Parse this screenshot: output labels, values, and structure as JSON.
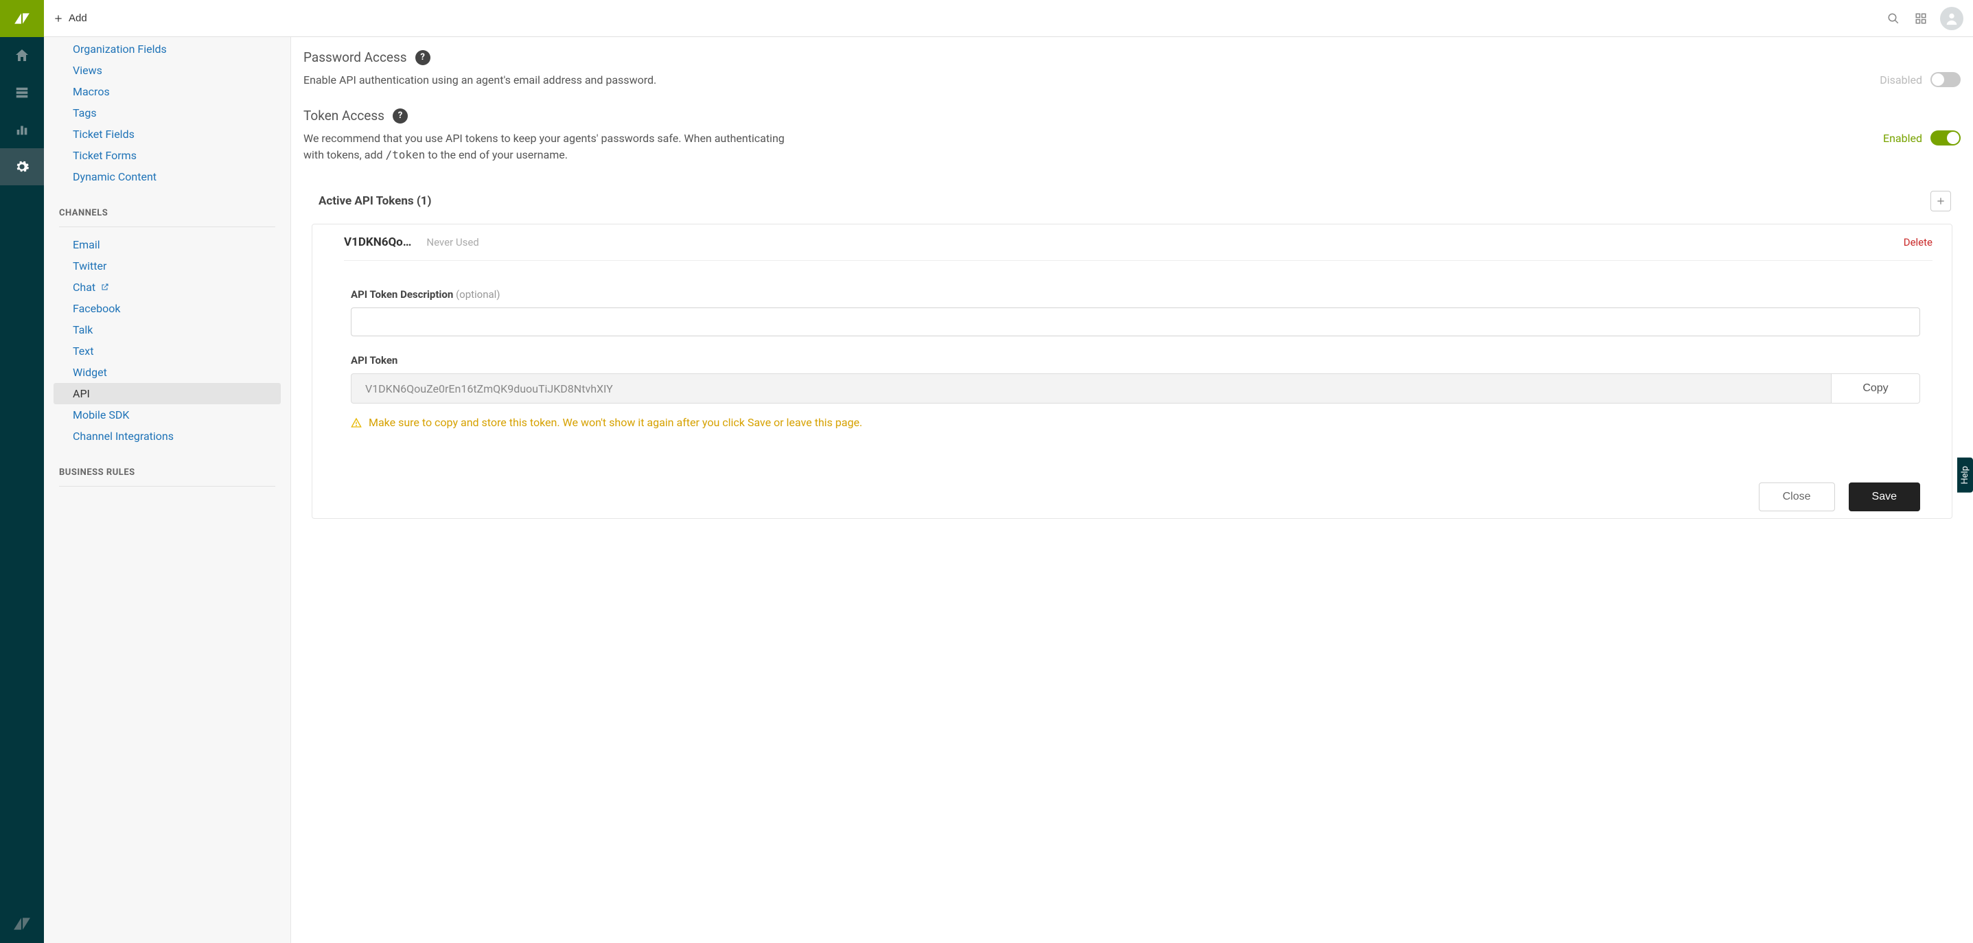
{
  "topbar": {
    "add_label": "Add"
  },
  "sidebar": {
    "manage_items": [
      {
        "label": "Organization Fields"
      },
      {
        "label": "Views"
      },
      {
        "label": "Macros"
      },
      {
        "label": "Tags"
      },
      {
        "label": "Ticket Fields"
      },
      {
        "label": "Ticket Forms"
      },
      {
        "label": "Dynamic Content"
      }
    ],
    "channels_header": "CHANNELS",
    "channels_items": [
      {
        "label": "Email"
      },
      {
        "label": "Twitter"
      },
      {
        "label": "Chat",
        "external": true
      },
      {
        "label": "Facebook"
      },
      {
        "label": "Talk"
      },
      {
        "label": "Text"
      },
      {
        "label": "Widget"
      },
      {
        "label": "API",
        "selected": true
      },
      {
        "label": "Mobile SDK"
      },
      {
        "label": "Channel Integrations"
      }
    ],
    "business_header": "BUSINESS RULES"
  },
  "password_section": {
    "title": "Password Access",
    "desc": "Enable API authentication using an agent's email address and password.",
    "state_label": "Disabled",
    "enabled": false
  },
  "token_section": {
    "title": "Token Access",
    "desc_pre": "We recommend that you use API tokens to keep your agents' passwords safe. When authenticating with tokens, add ",
    "desc_code": "/token",
    "desc_post": " to the end of your username.",
    "state_label": "Enabled",
    "enabled": true
  },
  "tokens_panel": {
    "header": "Active API Tokens (1)",
    "token_short": "V1DKN6Qo…",
    "token_meta": "Never Used",
    "delete_label": "Delete",
    "desc_label": "API Token Description",
    "desc_optional": "(optional)",
    "desc_value": "",
    "token_label": "API Token",
    "token_value": "V1DKN6QouZe0rEn16tZmQK9duouTiJKD8NtvhXIY",
    "copy_label": "Copy",
    "warning": "Make sure to copy and store this token. We won't show it again after you click Save or leave this page.",
    "close_label": "Close",
    "save_label": "Save"
  },
  "help_tab": "Help"
}
